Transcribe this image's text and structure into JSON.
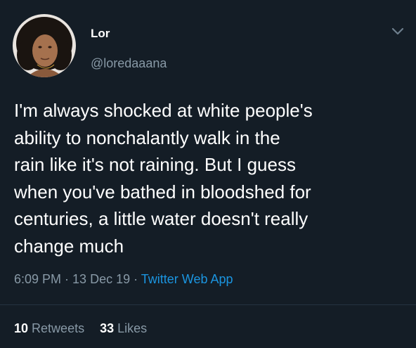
{
  "author": {
    "display_name": "Lor",
    "handle": "@loredaaana",
    "avatar_icon": "profile-photo"
  },
  "tweet": {
    "text": "I'm always shocked at white people's\nability to nonchalantly walk in the\nrain like it's not raining. But I guess\nwhen you've bathed in bloodshed for\ncenturies, a little water doesn't really\nchange much",
    "time": "6:09 PM",
    "sep1": " · ",
    "date": "13 Dec 19",
    "sep2": " · ",
    "source": "Twitter Web App"
  },
  "stats": {
    "retweets_count": "10",
    "retweets_label": "Retweets",
    "likes_count": "33",
    "likes_label": "Likes"
  },
  "colors": {
    "background": "#141d26",
    "primary_text": "#ffffff",
    "secondary_text": "#8899a6",
    "link": "#1b95e0",
    "divider": "#253341"
  }
}
